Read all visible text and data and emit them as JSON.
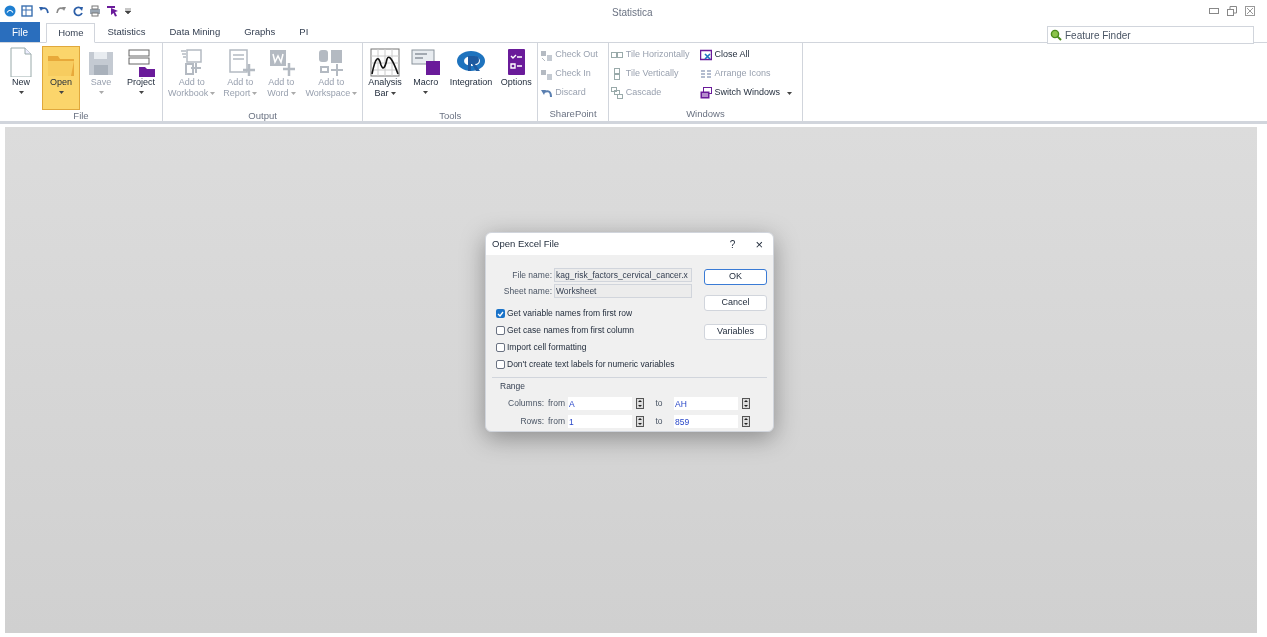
{
  "window": {
    "title": "Statistica"
  },
  "ribbon_tabs": [
    {
      "label": "File",
      "selected": false,
      "kind": "file"
    },
    {
      "label": "Home",
      "selected": true,
      "kind": "tab"
    },
    {
      "label": "Statistics",
      "selected": false,
      "kind": "tab"
    },
    {
      "label": "Data Mining",
      "selected": false,
      "kind": "tab"
    },
    {
      "label": "Graphs",
      "selected": false,
      "kind": "tab"
    },
    {
      "label": "PI",
      "selected": false,
      "kind": "tab"
    }
  ],
  "feature_finder": {
    "placeholder": "Feature Finder"
  },
  "ribbon_groups": [
    {
      "label": "File",
      "items": [
        {
          "kind": "large",
          "lines": [
            "New"
          ],
          "dropdown": true,
          "disabled": false,
          "selected": false
        },
        {
          "kind": "large",
          "lines": [
            "Open"
          ],
          "dropdown": true,
          "disabled": false,
          "selected": true
        },
        {
          "kind": "large",
          "lines": [
            "Save"
          ],
          "dropdown": true,
          "disabled": true,
          "selected": false
        },
        {
          "kind": "large",
          "lines": [
            "Project"
          ],
          "dropdown": true,
          "disabled": false,
          "selected": false
        }
      ]
    },
    {
      "label": "Output",
      "items": [
        {
          "kind": "large",
          "lines": [
            "Add to",
            "Workbook"
          ],
          "dropdown": true,
          "disabled": true,
          "selected": false
        },
        {
          "kind": "large",
          "lines": [
            "Add to",
            "Report"
          ],
          "dropdown": true,
          "disabled": true,
          "selected": false
        },
        {
          "kind": "large",
          "lines": [
            "Add to",
            "Word"
          ],
          "dropdown": true,
          "disabled": true,
          "selected": false
        },
        {
          "kind": "large",
          "lines": [
            "Add to",
            "Workspace"
          ],
          "dropdown": true,
          "disabled": true,
          "selected": false
        }
      ]
    },
    {
      "label": "Tools",
      "items": [
        {
          "kind": "large",
          "lines": [
            "Analysis",
            "Bar"
          ],
          "dropdown": true,
          "disabled": false,
          "selected": false
        },
        {
          "kind": "large",
          "lines": [
            "Macro"
          ],
          "dropdown": true,
          "disabled": false,
          "selected": false
        },
        {
          "kind": "large",
          "lines": [
            "Integration"
          ],
          "disabled": false,
          "selected": false
        },
        {
          "kind": "large",
          "lines": [
            "Options"
          ],
          "disabled": false,
          "selected": false
        }
      ]
    },
    {
      "label": "SharePoint",
      "columns": [
        [
          {
            "kind": "small",
            "label": "Check Out",
            "disabled": true
          },
          {
            "kind": "small",
            "label": "Check In",
            "disabled": true
          },
          {
            "kind": "small",
            "label": "Discard",
            "disabled": true
          }
        ]
      ]
    },
    {
      "label": "Windows",
      "columns": [
        [
          {
            "kind": "small",
            "label": "Tile Horizontally",
            "disabled": true
          },
          {
            "kind": "small",
            "label": "Tile Vertically",
            "disabled": true
          },
          {
            "kind": "small",
            "label": "Cascade",
            "disabled": true
          }
        ],
        [
          {
            "kind": "small",
            "label": "Close All",
            "disabled": false
          },
          {
            "kind": "small",
            "label": "Arrange Icons",
            "disabled": true
          },
          {
            "kind": "small",
            "label": "Switch Windows",
            "disabled": false,
            "dropdown": true
          }
        ]
      ]
    }
  ],
  "dialog": {
    "title": "Open Excel File",
    "help": "?",
    "close": "×",
    "fields": [
      {
        "label": "File name:",
        "value": "kag_risk_factors_cervical_cancer.x"
      },
      {
        "label": "Sheet name:",
        "value": "Worksheet"
      }
    ],
    "buttons": [
      {
        "label": "OK",
        "default": true
      },
      {
        "label": "Cancel",
        "default": false
      },
      {
        "label": "Variables",
        "default": false
      }
    ],
    "checkboxes": [
      {
        "label": "Get variable names from first row",
        "checked": true
      },
      {
        "label": "Get case names from first column",
        "checked": false
      },
      {
        "label": "Import cell formatting",
        "checked": false
      },
      {
        "label": "Don't create text labels for numeric variables",
        "checked": false
      }
    ],
    "range": {
      "label": "Range",
      "rows": [
        {
          "label": "Columns:",
          "from_label": "from",
          "from": "A",
          "to_label": "to",
          "to": "AH"
        },
        {
          "label": "Rows:",
          "from_label": "from",
          "from": "1",
          "to_label": "to",
          "to": "859"
        }
      ]
    }
  }
}
